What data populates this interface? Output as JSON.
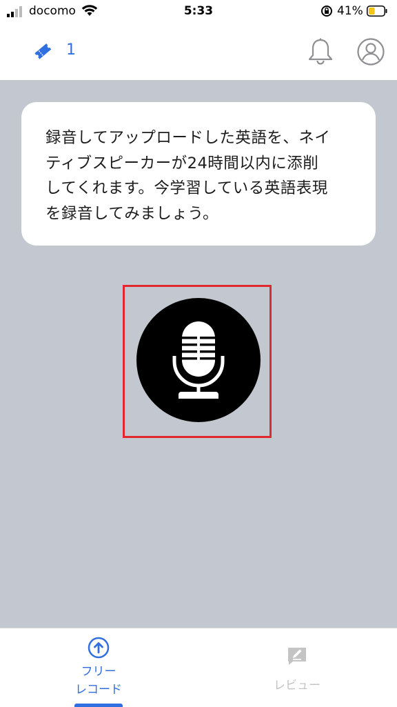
{
  "status_bar": {
    "carrier": "docomo",
    "time": "5:33",
    "battery_percent": "41%",
    "battery_level": 0.41
  },
  "header": {
    "ticket_count": "1"
  },
  "message": {
    "lines": [
      "録音してアップロードした英語を、ネイ",
      "ティブスピーカーが24時間以内に添削",
      "してくれます。今学習している英語表現",
      "を録音してみましょう。"
    ]
  },
  "tabs": {
    "free_record_line1": "フリー",
    "free_record_line2": "レコード",
    "review": "レビュー"
  },
  "colors": {
    "accent": "#2f6fe0",
    "background": "#c3c8d0",
    "highlight": "#e1282e",
    "battery": "#f5c518"
  },
  "icons": [
    "ticket-icon",
    "bell-icon",
    "profile-icon",
    "microphone-icon",
    "upload-icon",
    "review-icon"
  ]
}
